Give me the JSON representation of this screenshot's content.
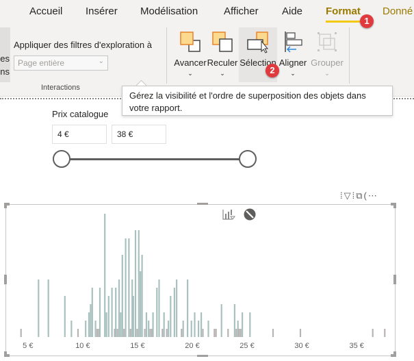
{
  "ribbon": {
    "tabs": [
      {
        "label": "Accueil",
        "active": false
      },
      {
        "label": "Insérer",
        "active": false
      },
      {
        "label": "Modélisation",
        "active": false
      },
      {
        "label": "Afficher",
        "active": false
      },
      {
        "label": "Aide",
        "active": false
      },
      {
        "label": "Format",
        "active": true
      },
      {
        "label": "Donné",
        "active": false
      }
    ],
    "left_stub_lines": [
      "es",
      "ns"
    ],
    "interactions": {
      "filter_label": "Appliquer des filtres d'exploration à",
      "select_value": "Page entière",
      "group_label": "Interactions"
    },
    "buttons": [
      {
        "label": "Avancer",
        "icon": "bring-forward-icon",
        "has_dropdown": true,
        "enabled": true
      },
      {
        "label": "Reculer",
        "icon": "send-backward-icon",
        "has_dropdown": true,
        "enabled": true
      },
      {
        "label": "Sélection",
        "icon": "selection-pane-icon",
        "has_dropdown": false,
        "enabled": true,
        "hovered": true
      },
      {
        "label": "Aligner",
        "icon": "align-icon",
        "has_dropdown": true,
        "enabled": true
      },
      {
        "label": "Grouper",
        "icon": "group-icon",
        "has_dropdown": true,
        "enabled": false
      }
    ],
    "chevron": "⌄"
  },
  "annotations": [
    {
      "number": "1",
      "target": "Format tab"
    },
    {
      "number": "2",
      "target": "Sélection button"
    }
  ],
  "tooltip": {
    "line1": "Gérez la visibilité et l'ordre de superposition des objets dans",
    "line2": "votre rapport."
  },
  "slicer": {
    "title": "Prix catalogue",
    "min_value": "4 €",
    "max_value": "38 €",
    "range_min": 4,
    "range_max": 38
  },
  "visual_header": {
    "icons": [
      "drill-icon",
      "filter-icon",
      "focus-mode-icon",
      "more-options-icon"
    ],
    "glyphs": "⁞▽⁞⧉(⋯"
  },
  "colors": {
    "accent": "#f2c811",
    "format_tab": "#9a7b00",
    "badge": "#e03a3e",
    "bar": "#a9c1be",
    "bar_dark": "#b8b4b4"
  },
  "chart_data": {
    "type": "bar",
    "title": "",
    "xlabel": "",
    "ylabel": "",
    "x_ticks": [
      "5 €",
      "10 €",
      "15 €",
      "20 €",
      "25 €",
      "30 €",
      "35 €"
    ],
    "x_tick_values": [
      5,
      10,
      15,
      20,
      25,
      30,
      35
    ],
    "xlim": [
      3.7,
      38.3
    ],
    "ylim": [
      0,
      15
    ],
    "grid": false,
    "bars": [
      {
        "x": 4.3,
        "v": 1
      },
      {
        "x": 5.9,
        "v": 7
      },
      {
        "x": 6.8,
        "v": 7
      },
      {
        "x": 8.3,
        "v": 5
      },
      {
        "x": 8.9,
        "v": 2
      },
      {
        "x": 9.5,
        "v": 1
      },
      {
        "x": 10.2,
        "v": 2
      },
      {
        "x": 10.5,
        "v": 3
      },
      {
        "x": 10.65,
        "v": 4
      },
      {
        "x": 10.8,
        "v": 6
      },
      {
        "x": 11.1,
        "v": 2
      },
      {
        "x": 11.25,
        "v": 1
      },
      {
        "x": 11.4,
        "v": 1
      },
      {
        "x": 11.5,
        "v": 6
      },
      {
        "x": 11.95,
        "v": 15
      },
      {
        "x": 12.1,
        "v": 3
      },
      {
        "x": 12.3,
        "v": 5
      },
      {
        "x": 12.6,
        "v": 6
      },
      {
        "x": 12.85,
        "v": 1
      },
      {
        "x": 12.95,
        "v": 6
      },
      {
        "x": 13.1,
        "v": 1
      },
      {
        "x": 13.25,
        "v": 7
      },
      {
        "x": 13.4,
        "v": 3
      },
      {
        "x": 13.55,
        "v": 10
      },
      {
        "x": 13.7,
        "v": 1
      },
      {
        "x": 13.85,
        "v": 12
      },
      {
        "x": 14.15,
        "v": 12
      },
      {
        "x": 14.3,
        "v": 1
      },
      {
        "x": 14.45,
        "v": 7
      },
      {
        "x": 14.55,
        "v": 5
      },
      {
        "x": 14.75,
        "v": 13
      },
      {
        "x": 14.9,
        "v": 1
      },
      {
        "x": 15.05,
        "v": 13
      },
      {
        "x": 15.2,
        "v": 8
      },
      {
        "x": 15.35,
        "v": 10
      },
      {
        "x": 15.6,
        "v": 1
      },
      {
        "x": 15.75,
        "v": 3
      },
      {
        "x": 15.95,
        "v": 2
      },
      {
        "x": 16.1,
        "v": 1
      },
      {
        "x": 16.25,
        "v": 1
      },
      {
        "x": 16.35,
        "v": 3
      },
      {
        "x": 16.7,
        "v": 6
      },
      {
        "x": 16.9,
        "v": 7
      },
      {
        "x": 17.2,
        "v": 1
      },
      {
        "x": 17.35,
        "v": 3
      },
      {
        "x": 17.6,
        "v": 1
      },
      {
        "x": 17.75,
        "v": 2
      },
      {
        "x": 17.95,
        "v": 5
      },
      {
        "x": 18.3,
        "v": 6
      },
      {
        "x": 18.5,
        "v": 7
      },
      {
        "x": 18.95,
        "v": 1
      },
      {
        "x": 19.1,
        "v": 2
      },
      {
        "x": 19.5,
        "v": 7
      },
      {
        "x": 19.85,
        "v": 2
      },
      {
        "x": 20.15,
        "v": 3
      },
      {
        "x": 20.5,
        "v": 2
      },
      {
        "x": 20.75,
        "v": 3
      },
      {
        "x": 20.9,
        "v": 1
      },
      {
        "x": 21.4,
        "v": 2
      },
      {
        "x": 21.95,
        "v": 1
      },
      {
        "x": 22.1,
        "v": 1
      },
      {
        "x": 22.6,
        "v": 4
      },
      {
        "x": 23.2,
        "v": 1
      },
      {
        "x": 23.8,
        "v": 4
      },
      {
        "x": 23.95,
        "v": 1
      },
      {
        "x": 24.1,
        "v": 2
      },
      {
        "x": 24.2,
        "v": 1
      },
      {
        "x": 24.35,
        "v": 1
      },
      {
        "x": 24.5,
        "v": 3
      },
      {
        "x": 25.2,
        "v": 3
      },
      {
        "x": 27.3,
        "v": 1
      },
      {
        "x": 29.8,
        "v": 1
      },
      {
        "x": 36.4,
        "v": 1
      },
      {
        "x": 37.5,
        "v": 1
      }
    ]
  }
}
